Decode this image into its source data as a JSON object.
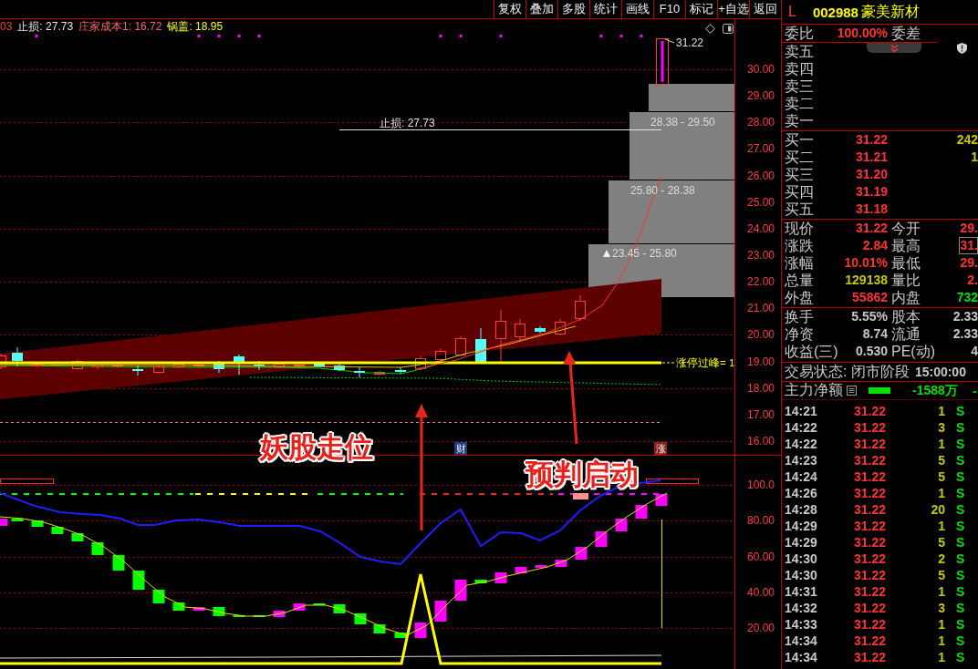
{
  "toolbar": {
    "buttons": [
      "复权",
      "叠加",
      "多股",
      "统计",
      "画线",
      "F10",
      "标记",
      "+自选",
      "返回"
    ]
  },
  "price_chart": {
    "legend": [
      {
        "text": "03",
        "color": "#ff3232"
      },
      {
        "text": "止损: 27.73",
        "color": "#e6e6e6"
      },
      {
        "text": "庄家成本1: 16.72",
        "color": "#ff6464"
      },
      {
        "text": "锅盖: 18.95",
        "color": "#ffff00"
      }
    ],
    "y_axis": [
      "30.00",
      "29.00",
      "28.00",
      "27.00",
      "26.00",
      "25.00",
      "24.00",
      "23.00",
      "22.00",
      "21.00",
      "20.00",
      "19.00",
      "18.00",
      "17.00",
      "16.00"
    ],
    "last_price": "31.22",
    "stop_loss": "止损: 27.73",
    "ranges": [
      {
        "label": "28.38 - 29.50",
        "marker": false
      },
      {
        "label": "25.80 - 28.38",
        "marker": false
      },
      {
        "label": "23.45 - 25.80",
        "marker": true
      }
    ],
    "peak_label": "涨停过峰= 1",
    "event_tags": [
      {
        "text": "财",
        "color": "#1e3c82"
      },
      {
        "text": "涨",
        "color": "#8c1e1e"
      }
    ],
    "annotations": [
      "妖股走位",
      "预判启动"
    ]
  },
  "indicator_chart": {
    "y_axis": [
      "100.0",
      "80.00",
      "60.00",
      "40.00",
      "20.00"
    ]
  },
  "quote_panel": {
    "flag": "L",
    "code": "002988",
    "name": "豪美新材",
    "order_ratio": {
      "label": "委比",
      "value": "100.00%",
      "diff_label": "委差"
    },
    "asks": [
      {
        "label": "卖五"
      },
      {
        "label": "卖四"
      },
      {
        "label": "卖三"
      },
      {
        "label": "卖二"
      },
      {
        "label": "卖一"
      }
    ],
    "bids": [
      {
        "label": "买一",
        "price": "31.22",
        "volume": "242"
      },
      {
        "label": "买二",
        "price": "31.21",
        "volume": "1"
      },
      {
        "label": "买三",
        "price": "31.20"
      },
      {
        "label": "买四",
        "price": "31.19"
      },
      {
        "label": "买五",
        "price": "31.18"
      }
    ],
    "stats": [
      {
        "label": "现价",
        "value": "31.22",
        "color": "#ff3232",
        "boxed": false
      },
      {
        "label": "今开",
        "value": "29.",
        "color": "#ff3232",
        "boxed": false
      },
      {
        "label": "涨跌",
        "value": "2.84",
        "color": "#ff3232",
        "boxed": false
      },
      {
        "label": "最高",
        "value": "31.",
        "color": "#ff3232",
        "boxed": true
      },
      {
        "label": "涨幅",
        "value": "10.01%",
        "color": "#ff3232",
        "boxed": false
      },
      {
        "label": "最低",
        "value": "29.",
        "color": "#ff3232",
        "boxed": false
      },
      {
        "label": "总量",
        "value": "129138",
        "color": "#c8c800",
        "boxed": false
      },
      {
        "label": "量比",
        "value": "2.",
        "color": "#ff3232",
        "boxed": false
      },
      {
        "label": "外盘",
        "value": "55862",
        "color": "#ff3232",
        "boxed": false
      },
      {
        "label": "内盘",
        "value": "732",
        "color": "#00e000",
        "boxed": false
      }
    ],
    "fundamentals": [
      {
        "label": "换手",
        "value": "5.55%"
      },
      {
        "label": "股本",
        "value": "2.33"
      },
      {
        "label": "净资",
        "value": "8.74"
      },
      {
        "label": "流通",
        "value": "2.33"
      },
      {
        "label": "收益(三)",
        "value": "0.530"
      },
      {
        "label": "PE(动)",
        "value": "4"
      }
    ],
    "trade_status": {
      "label": "交易状态: 闭市阶段",
      "time": "15:00:00"
    },
    "main_flow": {
      "label": "主力净额",
      "value": "-1588万",
      "column_3": "-"
    },
    "ticks": [
      {
        "time": "14:21",
        "price": "31.22",
        "volume": "1",
        "side": "S"
      },
      {
        "time": "14:22",
        "price": "31.22",
        "volume": "3",
        "side": "S"
      },
      {
        "time": "14:22",
        "price": "31.22",
        "volume": "1",
        "side": "S"
      },
      {
        "time": "14:23",
        "price": "31.22",
        "volume": "5",
        "side": "S"
      },
      {
        "time": "14:24",
        "price": "31.22",
        "volume": "5",
        "side": "S"
      },
      {
        "time": "14:26",
        "price": "31.22",
        "volume": "1",
        "side": "S"
      },
      {
        "time": "14:28",
        "price": "31.22",
        "volume": "20",
        "side": "S"
      },
      {
        "time": "14:29",
        "price": "31.22",
        "volume": "1",
        "side": "S"
      },
      {
        "time": "14:29",
        "price": "31.22",
        "volume": "5",
        "side": "S"
      },
      {
        "time": "14:30",
        "price": "31.22",
        "volume": "2",
        "side": "S"
      },
      {
        "time": "14:30",
        "price": "31.22",
        "volume": "5",
        "side": "S"
      },
      {
        "time": "14:31",
        "price": "31.22",
        "volume": "1",
        "side": "S"
      },
      {
        "time": "14:32",
        "price": "31.22",
        "volume": "3",
        "side": "S"
      },
      {
        "time": "14:33",
        "price": "31.22",
        "volume": "1",
        "side": "S"
      },
      {
        "time": "14:34",
        "price": "31.22",
        "volume": "1",
        "side": "S"
      },
      {
        "time": "14:34",
        "price": "31.22",
        "volume": "1",
        "side": "S"
      }
    ]
  }
}
